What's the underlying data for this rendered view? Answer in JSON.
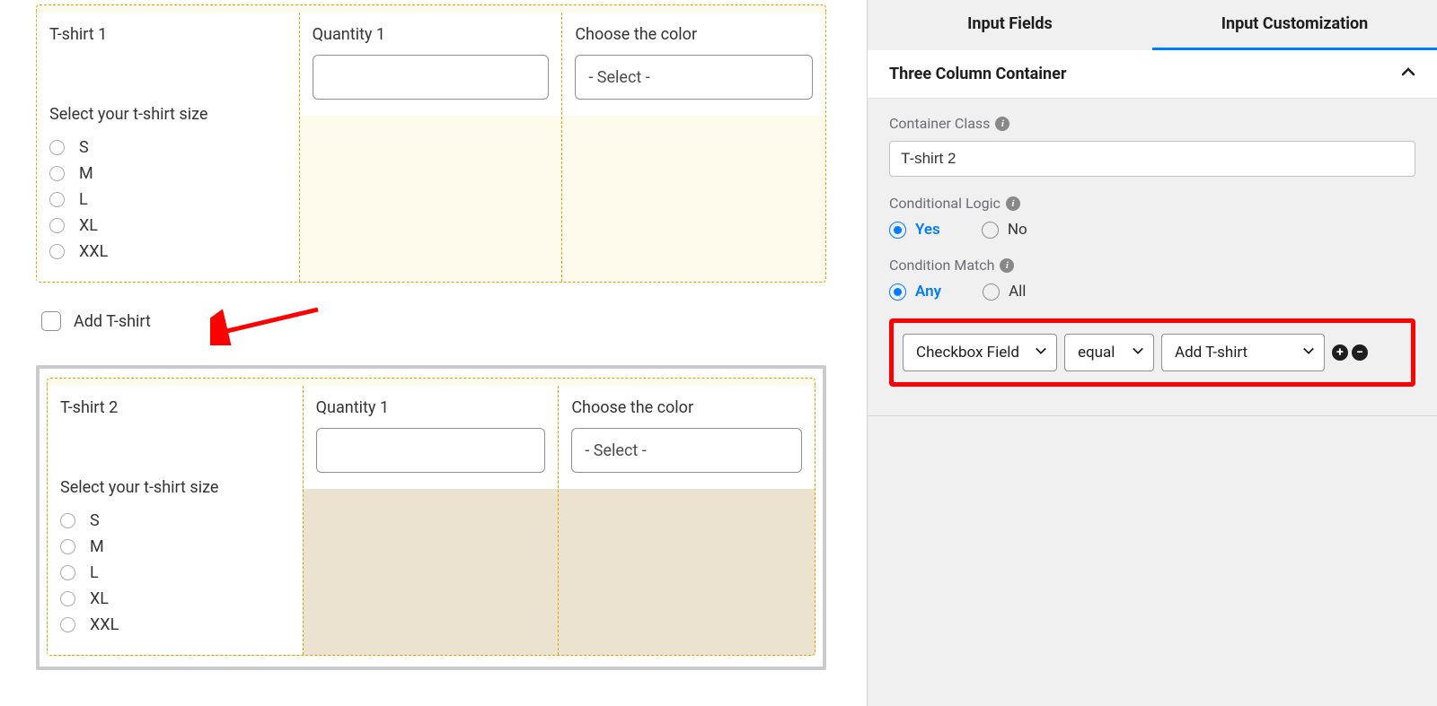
{
  "preview": {
    "container1": {
      "title": "T-shirt 1",
      "size_label": "Select your t-shirt size",
      "sizes": [
        "S",
        "M",
        "L",
        "XL",
        "XXL"
      ],
      "qty_label": "Quantity 1",
      "color_label": "Choose the color",
      "color_placeholder": "- Select -"
    },
    "checkbox": {
      "label": "Add T-shirt"
    },
    "container2": {
      "title": "T-shirt 2",
      "size_label": "Select your t-shirt size",
      "sizes": [
        "S",
        "M",
        "L",
        "XL",
        "XXL"
      ],
      "qty_label": "Quantity 1",
      "color_label": "Choose the color",
      "color_placeholder": "- Select -"
    }
  },
  "panel": {
    "tabs": {
      "fields": "Input Fields",
      "custom": "Input Customization"
    },
    "section_title": "Three Column Container",
    "container_class_label": "Container Class",
    "container_class_value": "T-shirt 2",
    "cond_logic_label": "Conditional Logic",
    "cond_logic": {
      "yes": "Yes",
      "no": "No"
    },
    "cond_match_label": "Condition Match",
    "cond_match": {
      "any": "Any",
      "all": "All"
    },
    "rule": {
      "field": "Checkbox Field",
      "op": "equal",
      "value": "Add T-shirt"
    }
  }
}
